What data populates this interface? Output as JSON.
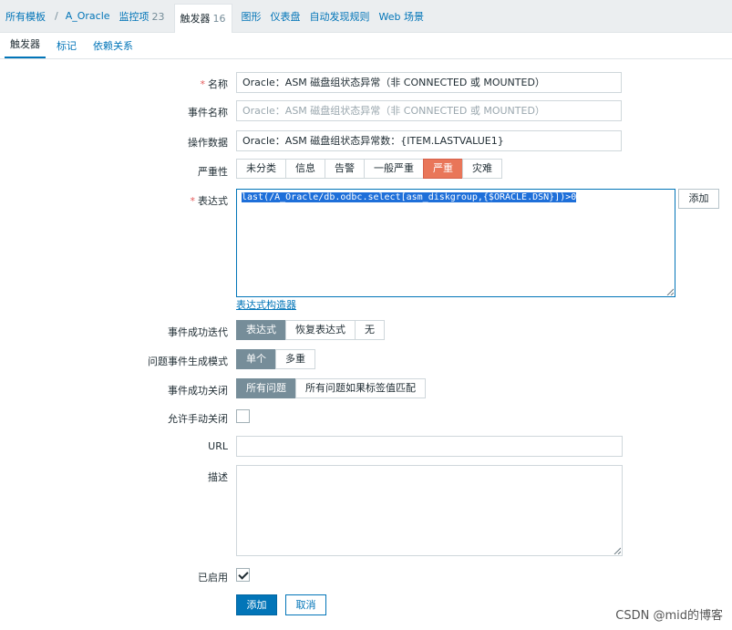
{
  "breadcrumb": {
    "all_templates": "所有模板",
    "sep": "/",
    "template": "A_Oracle",
    "items_label": "监控项",
    "items_count": "23",
    "triggers_label": "触发器",
    "triggers_count": "16",
    "graphs": "图形",
    "dashboards": "仪表盘",
    "discovery": "自动发现规则",
    "web": "Web 场景"
  },
  "tabs": [
    "触发器",
    "标记",
    "依赖关系"
  ],
  "form": {
    "name_label": "名称",
    "name_value": "Oracle：ASM 磁盘组状态异常（非 CONNECTED 或 MOUNTED）",
    "event_name_label": "事件名称",
    "event_name_placeholder": "Oracle：ASM 磁盘组状态异常（非 CONNECTED 或 MOUNTED）",
    "opdata_label": "操作数据",
    "opdata_value": "Oracle：ASM 磁盘组状态异常数：{ITEM.LASTVALUE1}",
    "severity_label": "严重性",
    "severity_options": [
      "未分类",
      "信息",
      "告警",
      "一般严重",
      "严重",
      "灾难"
    ],
    "severity_selected": "严重",
    "expression_label": "表达式",
    "expression_value": "last(/A_Oracle/db.odbc.select[asm_diskgroup,{$ORACLE.DSN}])>0",
    "expression_add": "添加",
    "expression_builder": "表达式构造器",
    "ok_event_label": "事件成功迭代",
    "ok_event_options": [
      "表达式",
      "恢复表达式",
      "无"
    ],
    "ok_event_selected": "表达式",
    "problem_mode_label": "问题事件生成模式",
    "problem_mode_options": [
      "单个",
      "多重"
    ],
    "problem_mode_selected": "单个",
    "ok_close_label": "事件成功关闭",
    "ok_close_options": [
      "所有问题",
      "所有问题如果标签值匹配"
    ],
    "ok_close_selected": "所有问题",
    "manual_close_label": "允许手动关闭",
    "manual_close_checked": false,
    "url_label": "URL",
    "url_value": "",
    "description_label": "描述",
    "description_value": "",
    "enabled_label": "已启用",
    "enabled_checked": true,
    "submit": "添加",
    "cancel": "取消"
  },
  "watermark": "CSDN @mid的博客",
  "colors": {
    "accent": "#0275b8",
    "severity_high": "#e97659",
    "selected_segment": "#768d99"
  }
}
